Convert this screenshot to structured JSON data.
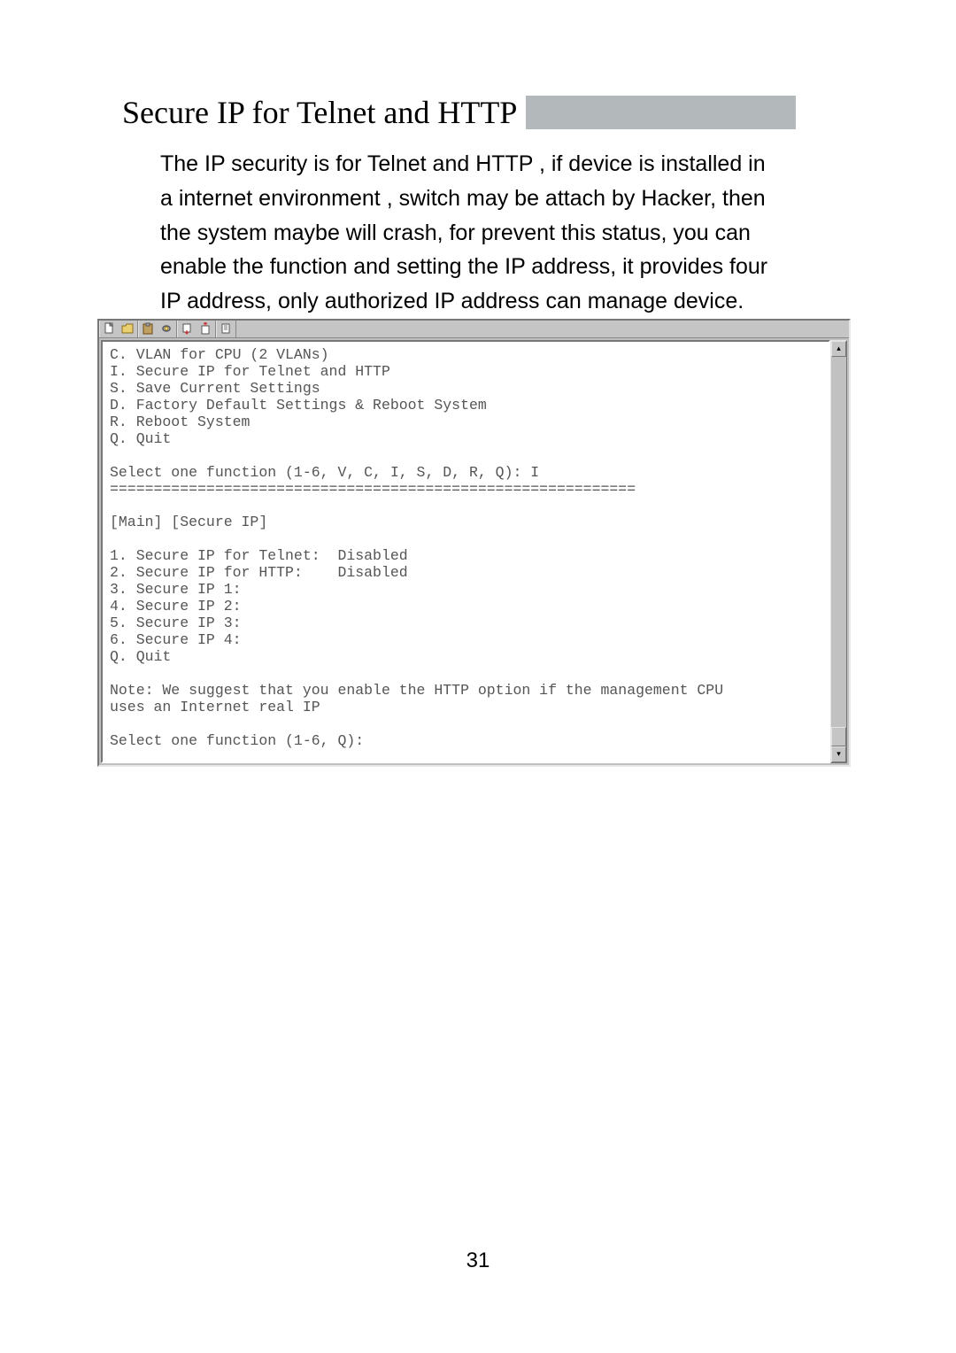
{
  "heading": "Secure IP for Telnet and HTTP",
  "body_text": "The IP security is for Telnet and HTTP , if device is installed in a internet environment , switch may be attach by Hacker, then the system maybe will crash, for prevent this status, you can enable the function and setting the IP address, it provides four IP address, only authorized IP address can manage device.",
  "toolbar": {
    "buttons": [
      {
        "name": "new-file-icon"
      },
      {
        "name": "open-file-icon"
      },
      {
        "name": "paste-icon"
      },
      {
        "name": "connect-icon"
      },
      {
        "name": "send-icon"
      },
      {
        "name": "receive-icon"
      },
      {
        "name": "properties-icon"
      }
    ]
  },
  "terminal_lines": [
    "C. VLAN for CPU (2 VLANs)",
    "I. Secure IP for Telnet and HTTP",
    "S. Save Current Settings",
    "D. Factory Default Settings & Reboot System",
    "R. Reboot System",
    "Q. Quit",
    "",
    "Select one function (1-6, V, C, I, S, D, R, Q): I",
    "============================================================",
    "",
    "[Main] [Secure IP]",
    "",
    "1. Secure IP for Telnet:  Disabled",
    "2. Secure IP for HTTP:    Disabled",
    "3. Secure IP 1:",
    "4. Secure IP 2:",
    "5. Secure IP 3:",
    "6. Secure IP 4:",
    "Q. Quit",
    "",
    "Note: We suggest that you enable the HTTP option if the management CPU",
    "uses an Internet real IP",
    "",
    "Select one function (1-6, Q):"
  ],
  "scrollbar": {
    "up": "▴",
    "down": "▾"
  },
  "page_number": "31"
}
